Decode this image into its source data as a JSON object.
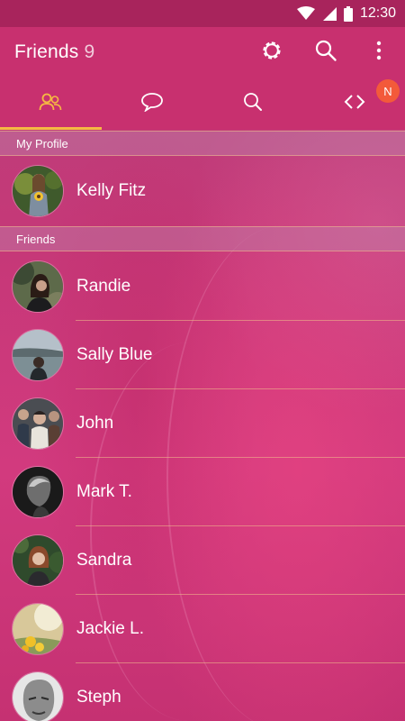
{
  "status_bar": {
    "time": "12:30"
  },
  "app_bar": {
    "title": "Friends",
    "count": "9"
  },
  "tabs": [
    {
      "name": "friends",
      "icon": "people-icon",
      "active": true
    },
    {
      "name": "chats",
      "icon": "chat-bubble-icon",
      "active": false
    },
    {
      "name": "search",
      "icon": "search-icon",
      "active": false
    },
    {
      "name": "more",
      "icon": "code-brackets-icon",
      "active": false,
      "badge": "N"
    }
  ],
  "sections": {
    "profile": "My Profile",
    "friends": "Friends"
  },
  "profile": {
    "name": "Kelly Fitz"
  },
  "friends": [
    {
      "name": "Randie"
    },
    {
      "name": "Sally Blue"
    },
    {
      "name": "John"
    },
    {
      "name": "Mark T."
    },
    {
      "name": "Sandra"
    },
    {
      "name": "Jackie L."
    },
    {
      "name": "Steph"
    }
  ],
  "colors": {
    "accent": "#f5b942",
    "badge": "#f35a3a",
    "app_bar": "#c8306f",
    "status_bar": "#a8245c"
  }
}
